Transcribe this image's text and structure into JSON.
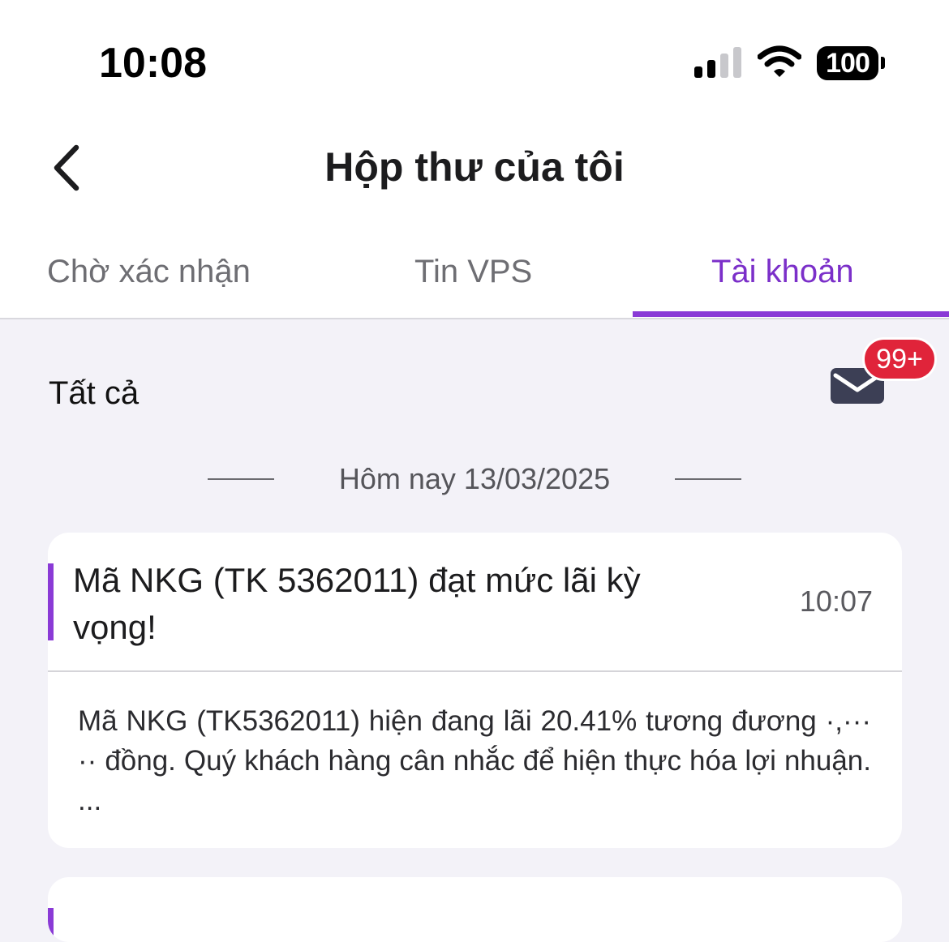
{
  "status_bar": {
    "time": "10:08",
    "battery_level": "100",
    "signal_bars_active": 2,
    "signal_bars_total": 4
  },
  "header": {
    "title": "Hộp thư của tôi",
    "back_icon": "chevron-left-icon"
  },
  "tabs": [
    {
      "label": "Chờ xác nhận",
      "active": false
    },
    {
      "label": "Tin VPS",
      "active": false
    },
    {
      "label": "Tài khoản",
      "active": true
    }
  ],
  "filter": {
    "label": "Tất cả",
    "mail_icon": "envelope-icon",
    "badge": "99+"
  },
  "date_separator": "Hôm nay 13/03/2025",
  "messages": [
    {
      "title": "Mã NKG (TK 5362011)  đạt mức lãi kỳ vọng!",
      "time": "10:07",
      "body": "Mã NKG (TK5362011) hiện đang lãi 20.41% tương đương ·,··· ·· đồng. Quý khách hàng cân nhắc để hiện thực hóa lợi nhuận. ..."
    }
  ],
  "colors": {
    "accent": "#8a3ad6",
    "accent_text": "#7b2fc9",
    "badge": "#e0243a",
    "background": "#f3f2f8",
    "envelope": "#3c3f55"
  }
}
